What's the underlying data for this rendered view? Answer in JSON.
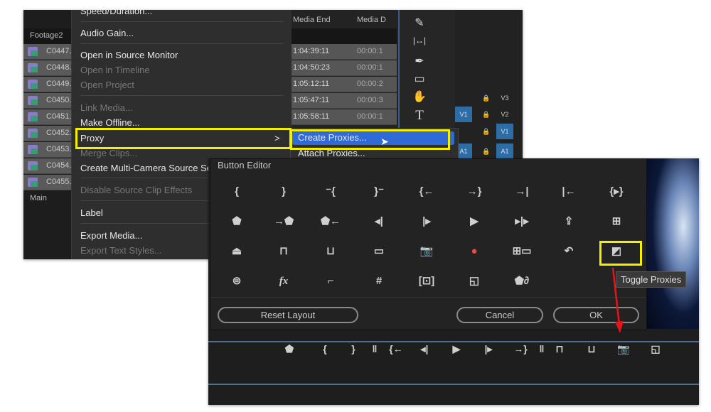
{
  "project": {
    "header": "Footage2",
    "clips": [
      "C0447.",
      "C0448.",
      "C0449.",
      "C0450.",
      "C0451.",
      "C0452.",
      "C0453.",
      "C0454.",
      "C0455."
    ],
    "footer": "Main"
  },
  "menu": {
    "items": [
      {
        "label": "Speed/Duration...",
        "disabled": false
      },
      {
        "label": "Audio Gain...",
        "disabled": false
      },
      {
        "label": "Open in Source Monitor",
        "disabled": false
      },
      {
        "label": "Open in Timeline",
        "disabled": true
      },
      {
        "label": "Open Project",
        "disabled": true
      },
      {
        "label": "Link Media...",
        "disabled": true
      },
      {
        "label": "Make Offline...",
        "disabled": false
      },
      {
        "label": "Proxy",
        "disabled": false
      },
      {
        "label": "Merge Clips...",
        "disabled": true
      },
      {
        "label": "Create Multi-Camera Source Sequence...",
        "disabled": false
      },
      {
        "label": "Disable Source Clip Effects",
        "disabled": true
      },
      {
        "label": "Label",
        "disabled": false
      },
      {
        "label": "Export Media...",
        "disabled": false
      },
      {
        "label": "Export Text Styles...",
        "disabled": true
      }
    ],
    "proxy_arrow": ">"
  },
  "submenu": {
    "items": [
      "Create Proxies...",
      "Attach Proxies..."
    ],
    "highlight_color": "#2f6ad6"
  },
  "table": {
    "headers": [
      "Media End",
      "Media D"
    ],
    "rows": [
      [
        "1:04:39:11",
        "00:00:1"
      ],
      [
        "1:04:50:23",
        "00:00:1"
      ],
      [
        "1:05:12:11",
        "00:00:2"
      ],
      [
        "1:05:47:11",
        "00:00:3"
      ],
      [
        "1:05:58:11",
        "00:00:1"
      ]
    ]
  },
  "tracks": [
    [
      "",
      "🔒",
      "V3"
    ],
    [
      "V1",
      "🔒",
      "V2"
    ],
    [
      "",
      "🔒",
      "V1"
    ],
    [
      "A1",
      "🔒",
      "A1"
    ]
  ],
  "tools": [
    "track-select-icon",
    "razor-icon",
    "slip-icon",
    "pen-icon",
    "rectangle-icon",
    "hand-icon",
    "type-icon"
  ],
  "button_editor": {
    "title": "Button Editor",
    "rows": [
      [
        "{",
        "}",
        "⁻{",
        "}⁻",
        "{←",
        "→}",
        "→|",
        "|←",
        "{▸}"
      ],
      [
        "⬟",
        "→⬟",
        "⬟←",
        "◂|",
        "|▸",
        "▶",
        "▸|▸",
        "⇪",
        "⊞"
      ],
      [
        "⏏",
        "⊓",
        "⊔",
        "▭",
        "📷",
        "●",
        "⊞▭",
        "↶",
        "◩"
      ],
      [
        "⊜",
        "fx",
        "⌐",
        "#",
        "[⊡]",
        "◱",
        "⬟∂"
      ]
    ],
    "reset_label": "Reset Layout",
    "cancel_label": "Cancel",
    "ok_label": "OK",
    "tooltip": "Toggle Proxies",
    "record_color": "#e84b4b",
    "highlight_color": "#f5f000",
    "arrow_color": "#e8141c"
  },
  "toolbar": {
    "buttons": [
      "⬟",
      "{",
      "}",
      "‖",
      "{←",
      "◂|",
      "▶",
      "|▸",
      "→}",
      "‖",
      "⊓",
      "⊔",
      "📷",
      "◱"
    ]
  }
}
